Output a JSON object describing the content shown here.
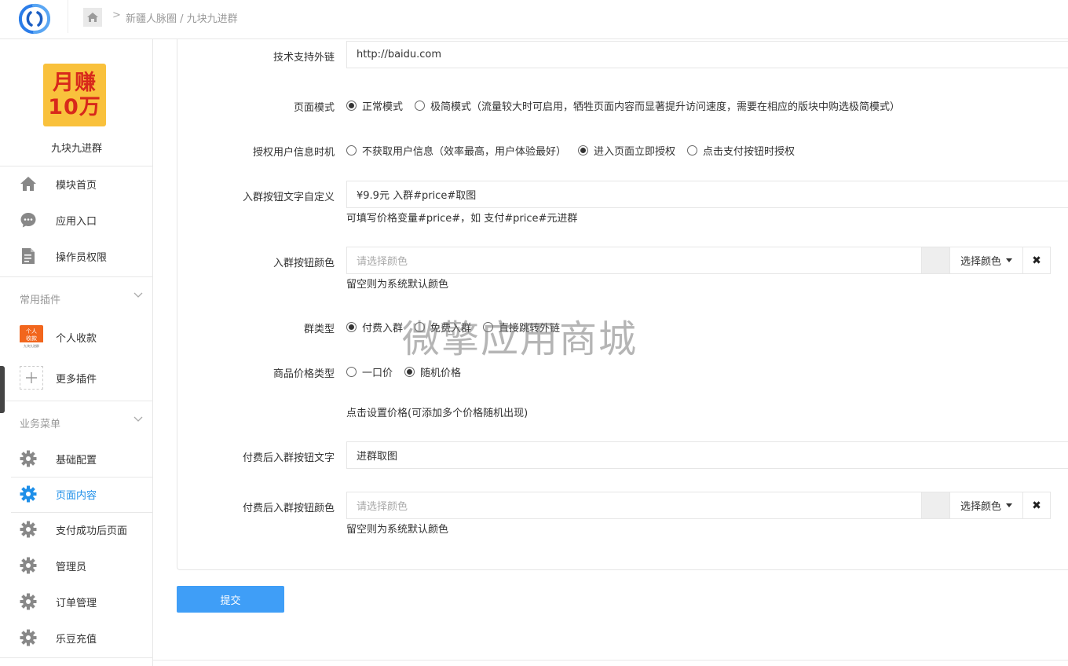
{
  "breadcrumb": {
    "path": "新疆人脉圈 / 九块九进群"
  },
  "app": {
    "name": "九块九进群",
    "logo_line1": "月赚",
    "logo_line2": "10万"
  },
  "sidebar": {
    "main_items": [
      {
        "label": "模块首页",
        "icon": "home-icon"
      },
      {
        "label": "应用入口",
        "icon": "chat-icon"
      },
      {
        "label": "操作员权限",
        "icon": "document-icon"
      }
    ],
    "plugin_group": {
      "title": "常用插件",
      "items": [
        {
          "label": "个人收款",
          "icon": "personal-payment-icon",
          "icon_text_top": "个人",
          "icon_text_mid": "收款",
          "icon_text_bottom": "九块九进群"
        },
        {
          "label": "更多插件",
          "icon": "plus-icon"
        }
      ]
    },
    "business_group": {
      "title": "业务菜单",
      "items": [
        {
          "label": "基础配置",
          "icon": "gear-icon",
          "active": false
        },
        {
          "label": "页面内容",
          "icon": "gear-icon",
          "active": true
        },
        {
          "label": "支付成功后页面",
          "icon": "gear-icon",
          "active": false
        },
        {
          "label": "管理员",
          "icon": "gear-icon",
          "active": false
        },
        {
          "label": "订单管理",
          "icon": "gear-icon",
          "active": false
        },
        {
          "label": "乐豆充值",
          "icon": "gear-icon",
          "active": false
        }
      ]
    }
  },
  "form": {
    "tech_link": {
      "label": "技术支持外链",
      "value": "http://baidu.com"
    },
    "page_mode": {
      "label": "页面模式",
      "options": [
        "正常模式",
        "极简模式（流量较大时可启用，牺牲页面内容而显著提升访问速度，需要在相应的版块中购选极简模式）"
      ],
      "selected": 0
    },
    "auth_timing": {
      "label": "授权用户信息时机",
      "options": [
        "不获取用户信息（效率最高，用户体验最好）",
        "进入页面立即授权",
        "点击支付按钮时授权"
      ],
      "selected": 1
    },
    "join_btn_text": {
      "label": "入群按钮文字自定义",
      "value": "¥9.9元 入群#price#取图",
      "hint": "可填写价格变量#price#，如 支付#price#元进群"
    },
    "join_btn_color": {
      "label": "入群按钮颜色",
      "placeholder": "请选择颜色",
      "pick_label": "选择颜色",
      "clear": "✖",
      "hint": "留空则为系统默认颜色"
    },
    "group_type": {
      "label": "群类型",
      "options": [
        "付费入群",
        "免费入群",
        "直接跳转外链"
      ],
      "selected": 0
    },
    "price_type": {
      "label": "商品价格类型",
      "options": [
        "一口价",
        "随机价格"
      ],
      "selected": 1
    },
    "price_hint": "点击设置价格(可添加多个价格随机出现)",
    "paid_btn_text": {
      "label": "付费后入群按钮文字",
      "value": "进群取图"
    },
    "paid_btn_color": {
      "label": "付费后入群按钮颜色",
      "placeholder": "请选择颜色",
      "pick_label": "选择颜色",
      "clear": "✖",
      "hint": "留空则为系统默认颜色"
    }
  },
  "watermark": "微擎应用商城",
  "submit_label": "提交",
  "colors": {
    "accent": "#1e8fe9",
    "button": "#3f9ef7",
    "logo_bg": "#f9c13c",
    "logo_text": "#d8281b",
    "plugin_icon": "#f2661d"
  }
}
